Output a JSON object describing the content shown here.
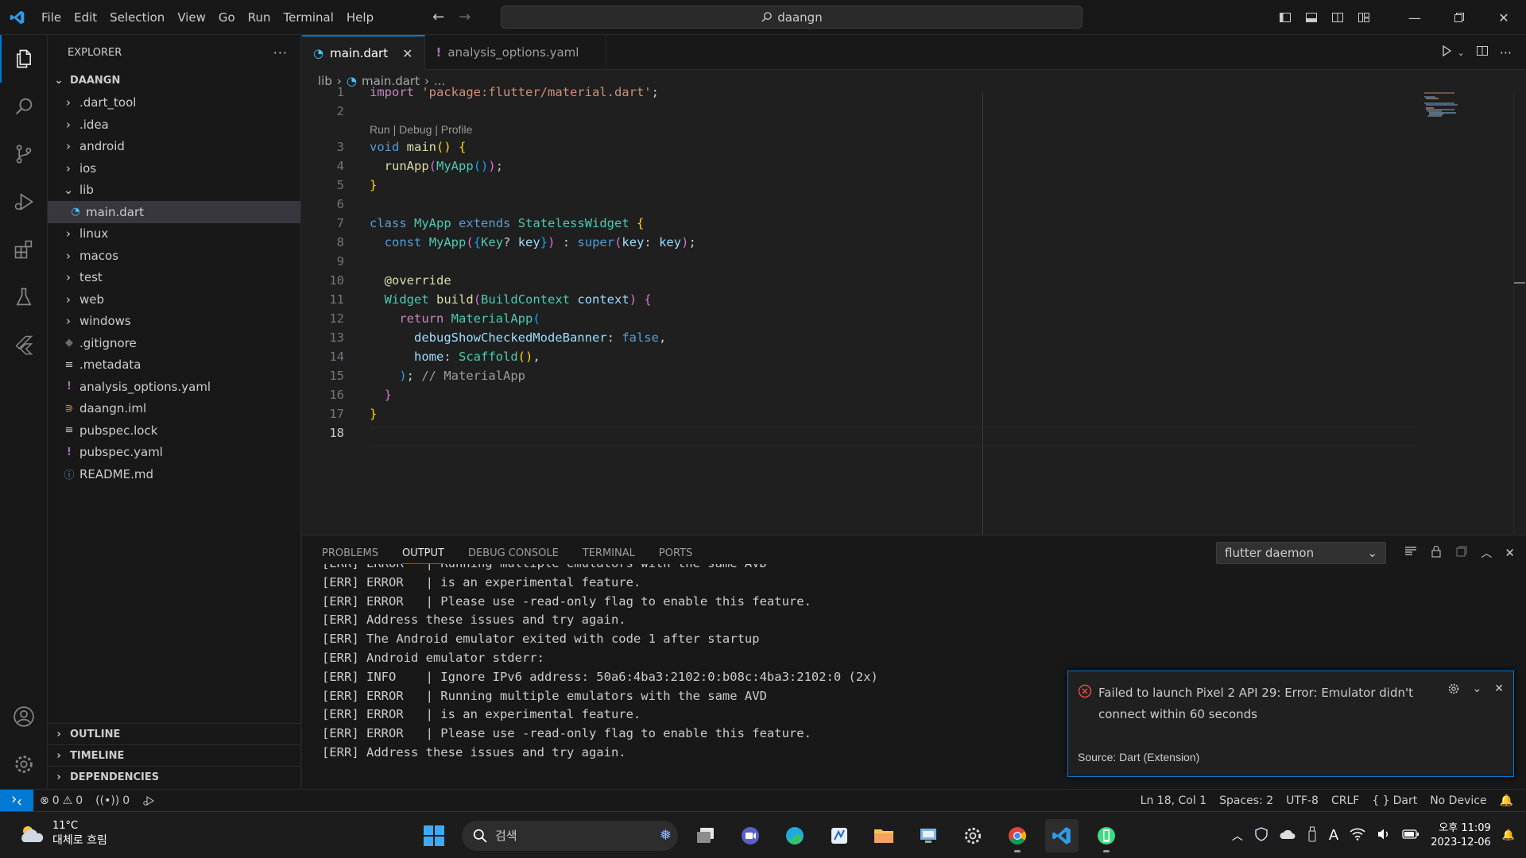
{
  "titlebar": {
    "menu": [
      "File",
      "Edit",
      "Selection",
      "View",
      "Go",
      "Run",
      "Terminal",
      "Help"
    ],
    "search_text": "daangn"
  },
  "explorer": {
    "header": "EXPLORER",
    "root": "DAANGN",
    "items": [
      {
        "label": ".dart_tool",
        "type": "folder"
      },
      {
        "label": ".idea",
        "type": "folder"
      },
      {
        "label": "android",
        "type": "folder"
      },
      {
        "label": "ios",
        "type": "folder"
      },
      {
        "label": "lib",
        "type": "folder-open"
      },
      {
        "label": "main.dart",
        "type": "dart"
      },
      {
        "label": "linux",
        "type": "folder"
      },
      {
        "label": "macos",
        "type": "folder"
      },
      {
        "label": "test",
        "type": "folder"
      },
      {
        "label": "web",
        "type": "folder"
      },
      {
        "label": "windows",
        "type": "folder"
      },
      {
        "label": ".gitignore",
        "type": "git"
      },
      {
        "label": ".metadata",
        "type": "lines"
      },
      {
        "label": "analysis_options.yaml",
        "type": "yaml"
      },
      {
        "label": "daangn.iml",
        "type": "rss"
      },
      {
        "label": "pubspec.lock",
        "type": "lines"
      },
      {
        "label": "pubspec.yaml",
        "type": "yaml"
      },
      {
        "label": "README.md",
        "type": "info"
      }
    ],
    "sections": [
      "OUTLINE",
      "TIMELINE",
      "DEPENDENCIES"
    ]
  },
  "tabs": [
    {
      "label": "main.dart",
      "active": true
    },
    {
      "label": "analysis_options.yaml",
      "active": false
    }
  ],
  "breadcrumb": {
    "folder": "lib",
    "file": "main.dart",
    "rest": "..."
  },
  "editor": {
    "codelens": "Run | Debug | Profile",
    "line_numbers": [
      "1",
      "2",
      "3",
      "4",
      "5",
      "6",
      "7",
      "8",
      "9",
      "10",
      "11",
      "12",
      "13",
      "14",
      "15",
      "16",
      "17",
      "18"
    ]
  },
  "panel": {
    "tabs": [
      "PROBLEMS",
      "OUTPUT",
      "DEBUG CONSOLE",
      "TERMINAL",
      "PORTS"
    ],
    "active_tab": "OUTPUT",
    "channel": "flutter daemon",
    "output_lines": [
      "[ERR] ERROR   | Running multiple emulators with the same AVD",
      "[ERR] ERROR   | is an experimental feature.",
      "[ERR] ERROR   | Please use -read-only flag to enable this feature.",
      "[ERR] Address these issues and try again.",
      "[ERR] The Android emulator exited with code 1 after startup",
      "[ERR] Android emulator stderr:",
      "[ERR] INFO    | Ignore IPv6 address: 50a6:4ba3:2102:0:b08c:4ba3:2102:0 (2x)",
      "[ERR] ERROR   | Running multiple emulators with the same AVD",
      "[ERR] ERROR   | is an experimental feature.",
      "[ERR] ERROR   | Please use -read-only flag to enable this feature.",
      "[ERR] Address these issues and try again."
    ]
  },
  "notification": {
    "message": "Failed to launch Pixel 2 API 29: Error: Emulator didn't connect within 60 seconds",
    "source": "Source: Dart (Extension)"
  },
  "statusbar": {
    "errors": "0",
    "warnings": "0",
    "ports": "0",
    "position": "Ln 18, Col 1",
    "spaces": "Spaces: 2",
    "encoding": "UTF-8",
    "eol": "CRLF",
    "language": "Dart",
    "device": "No Device"
  },
  "taskbar": {
    "temperature": "11°C",
    "weather": "대체로 흐림",
    "search_placeholder": "검색",
    "time": "오후 11:09",
    "date": "2023-12-06"
  },
  "colors": {
    "accent": "#0078d4",
    "error": "#f14c4c"
  }
}
